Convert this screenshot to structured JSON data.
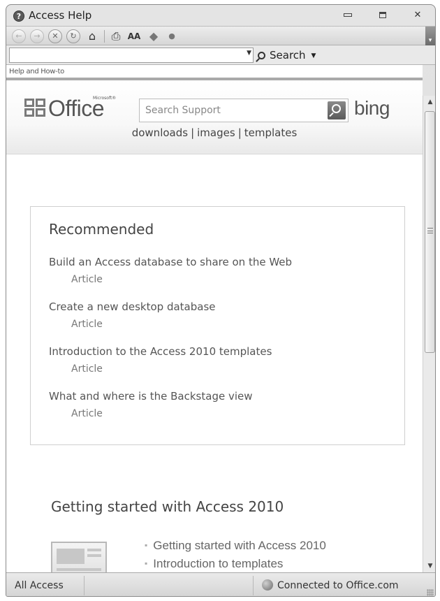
{
  "window": {
    "title": "Access Help",
    "help_glyph": "?",
    "close_glyph": "✕"
  },
  "toolbar": {
    "buttons": [
      {
        "icon": "back-icon",
        "glyph": "←",
        "enabled": false
      },
      {
        "icon": "forward-icon",
        "glyph": "→",
        "enabled": false
      },
      {
        "icon": "stop-icon",
        "glyph": "✕",
        "enabled": true
      },
      {
        "icon": "refresh-icon",
        "glyph": "↻",
        "enabled": true
      },
      {
        "icon": "home-icon",
        "glyph": "⌂",
        "enabled": true
      },
      {
        "icon": "print-icon",
        "glyph": "⎙",
        "enabled": true
      },
      {
        "icon": "text-size-icon",
        "glyph": "AA",
        "enabled": true
      },
      {
        "icon": "toc-book-icon",
        "glyph": "◆",
        "enabled": true
      },
      {
        "icon": "keep-on-top-icon",
        "glyph": "●",
        "enabled": true
      }
    ]
  },
  "search": {
    "value": "",
    "button_label": "Search"
  },
  "breadcrumb": "Help and How-to",
  "header": {
    "logo_text": "Office",
    "logo_super": "Microsoft®",
    "search_placeholder": "Search Support",
    "bing": "bing",
    "links": [
      "downloads",
      "images",
      "templates"
    ],
    "link_separator": "|"
  },
  "recommended": {
    "title": "Recommended",
    "items": [
      {
        "title": "Build an Access database to share on the Web",
        "type": "Article"
      },
      {
        "title": "Create a new desktop database",
        "type": "Article"
      },
      {
        "title": "Introduction to the Access 2010 templates",
        "type": "Article"
      },
      {
        "title": "What and where is the Backstage view",
        "type": "Article"
      }
    ]
  },
  "getting_started": {
    "title": "Getting started with Access 2010",
    "links": [
      "Getting started with Access 2010",
      "Introduction to templates"
    ]
  },
  "status": {
    "scope": "All Access",
    "connection": "Connected to Office.com"
  },
  "colors": {
    "chrome": "#d8d8d8",
    "text": "#444444",
    "border": "#cfcfcf"
  }
}
